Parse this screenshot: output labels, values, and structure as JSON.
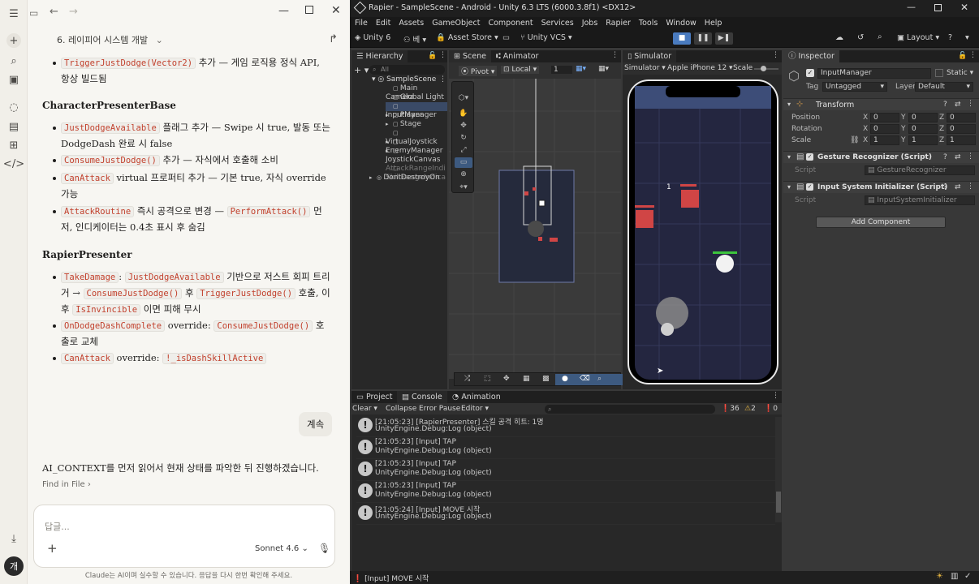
{
  "chat": {
    "title": "6. 레이피어 시스템 개발",
    "bullet0_code": "TriggerJustDodge(Vector2)",
    "bullet0_text": " 추가 — 게임 로직용 정식 API, 항상 빌드됨",
    "section1": "CharacterPresenterBase",
    "s1_b1_code": "JustDodgeAvailable",
    "s1_b1_text": " 플래그 추가 — Swipe 시 true, 발동 또는 DodgeDash 완료 시 false",
    "s1_b2_code": "ConsumeJustDodge()",
    "s1_b2_text": " 추가 — 자식에서 호출해 소비",
    "s1_b3_code": "CanAttack",
    "s1_b3_text": " virtual 프로퍼티 추가 — 기본 true, 자식 override 가능",
    "s1_b4_code": "AttackRoutine",
    "s1_b4_text": " 즉시 공격으로 변경 — ",
    "s1_b4_code2": "PerformAttack()",
    "s1_b4_text2": " 먼저, 인디케이터는 0.4초 표시 후 숨김",
    "section2": "RapierPresenter",
    "s2_b1_code": "TakeDamage",
    "s2_b1_t1": ": ",
    "s2_b1_code2": "JustDodgeAvailable",
    "s2_b1_t2": " 기반으로 저스트 회피 트리거 → ",
    "s2_b1_code3": "ConsumeJustDodge()",
    "s2_b1_t3": " 후 ",
    "s2_b1_code4": "TriggerJustDodge()",
    "s2_b1_t4": " 호출, 이후 ",
    "s2_b1_code5": "IsInvincible",
    "s2_b1_t5": " 이면 피해 무시",
    "s2_b2_code": "OnDodgeDashComplete",
    "s2_b2_t1": " override: ",
    "s2_b2_code2": "ConsumeJustDodge()",
    "s2_b2_t2": " 호출로 교체",
    "s2_b3_code": "CanAttack",
    "s2_b3_t1": " override: ",
    "s2_b3_code2": "!_isDashSkillActive",
    "user_msg": "계속",
    "reply": "AI_CONTEXT를 먼저 읽어서 현재 상태를 파악한 뒤 진행하겠습니다.",
    "find_in_file": "Find in File",
    "input_placeholder": "답글...",
    "model": "Sonnet 4.6",
    "disclaimer": "Claude는 AI이며 실수할 수 있습니다. 응답을 다시 한번 확인해 주세요.",
    "avatar": "개"
  },
  "unity": {
    "window_title": "Rapier - SampleScene - Android - Unity 6.3 LTS (6000.3.8f1) <DX12>",
    "menu": [
      "File",
      "Edit",
      "Assets",
      "GameObject",
      "Component",
      "Services",
      "Jobs",
      "Rapier",
      "Tools",
      "Window",
      "Help"
    ],
    "toolbar": {
      "unity": "Unity 6",
      "account": "베",
      "asset_store": "Asset Store",
      "vcs": "Unity VCS",
      "layout": "Layout"
    },
    "hierarchy": {
      "tab": "Hierarchy",
      "search": "All",
      "scene": "SampleScene",
      "items": [
        "Main Camera",
        "Global Light 2D",
        "InputManager",
        "Player",
        "Stage",
        "VirtualJoystick",
        "EnemyManager",
        "JoystickCanvas",
        "AttackRangeIndi",
        "SkillRangeIndica",
        "DontDestroyOn"
      ]
    },
    "scene": {
      "tab": "Scene",
      "animator_tab": "Animator",
      "pivot": "Pivot",
      "local": "Local",
      "grid_num": "1"
    },
    "simulator": {
      "tab": "Simulator",
      "mode": "Simulator",
      "device": "Apple iPhone 12",
      "scale": "Scale",
      "enemy_label": "1"
    },
    "inspector": {
      "tab": "Inspector",
      "object": "InputManager",
      "static": "Static",
      "tag_label": "Tag",
      "tag": "Untagged",
      "layer_label": "Layer",
      "layer": "Default",
      "transform": "Transform",
      "position": "Position",
      "rotation": "Rotation",
      "scale": "Scale",
      "x": "X",
      "y": "Y",
      "z": "Z",
      "pos": [
        "0",
        "0",
        "0"
      ],
      "rot": [
        "0",
        "0",
        "0"
      ],
      "scl": [
        "1",
        "1",
        "1"
      ],
      "comp1": "Gesture Recognizer (Script)",
      "comp1_script_label": "Script",
      "comp1_script": "GestureRecognizer",
      "comp2": "Input System Initializer (Script)",
      "comp2_script_label": "Script",
      "comp2_script": "InputSystemInitializer",
      "add_component": "Add Component"
    },
    "console": {
      "tabs": [
        "Project",
        "Console",
        "Animation"
      ],
      "clear": "Clear",
      "collapse": "Collapse",
      "error_pause": "Error Pause",
      "editor": "Editor",
      "count_log": "36",
      "count_warn": "2",
      "count_err": "0",
      "logs": [
        {
          "l1": "[21:05:23] [RapierPresenter] 스킬 공격 히트: 1명",
          "l2": "UnityEngine.Debug:Log (object)"
        },
        {
          "l1": "[21:05:23] [Input] TAP",
          "l2": "UnityEngine.Debug:Log (object)"
        },
        {
          "l1": "[21:05:23] [Input] TAP",
          "l2": "UnityEngine.Debug:Log (object)"
        },
        {
          "l1": "[21:05:23] [Input] TAP",
          "l2": "UnityEngine.Debug:Log (object)"
        },
        {
          "l1": "[21:05:24] [Input] MOVE 시작",
          "l2": "UnityEngine.Debug:Log (object)"
        }
      ],
      "status": "[Input] MOVE 시작"
    }
  }
}
